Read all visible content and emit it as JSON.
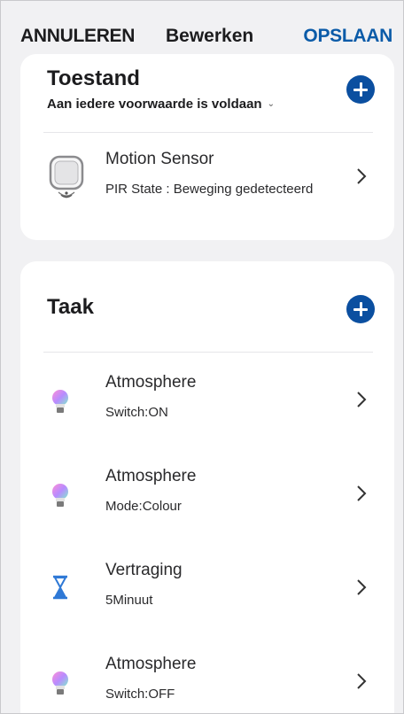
{
  "topbar": {
    "cancel_label": "ANNULEREN",
    "title": "Bewerken",
    "save_label": "OPSLAAN"
  },
  "condition": {
    "title": "Toestand",
    "subtitle": "Aan iedere voorwaarde is voldaan",
    "items": [
      {
        "name": "Motion Sensor",
        "detail": "PIR State : Beweging gedetecteerd",
        "icon": "motion-sensor-icon"
      }
    ]
  },
  "task": {
    "title": "Taak",
    "items": [
      {
        "name": "Atmosphere",
        "detail": "Switch:ON",
        "icon": "bulb-icon"
      },
      {
        "name": "Atmosphere",
        "detail": "Mode:Colour",
        "icon": "bulb-icon"
      },
      {
        "name": "Vertraging",
        "detail": "5Minuut",
        "icon": "hourglass-icon"
      },
      {
        "name": "Atmosphere",
        "detail": "Switch:OFF",
        "icon": "bulb-icon"
      }
    ]
  },
  "colors": {
    "accent": "#0b5ba8",
    "plus_button": "#0b4fa0",
    "background": "#f1f1f3",
    "card": "#ffffff"
  }
}
